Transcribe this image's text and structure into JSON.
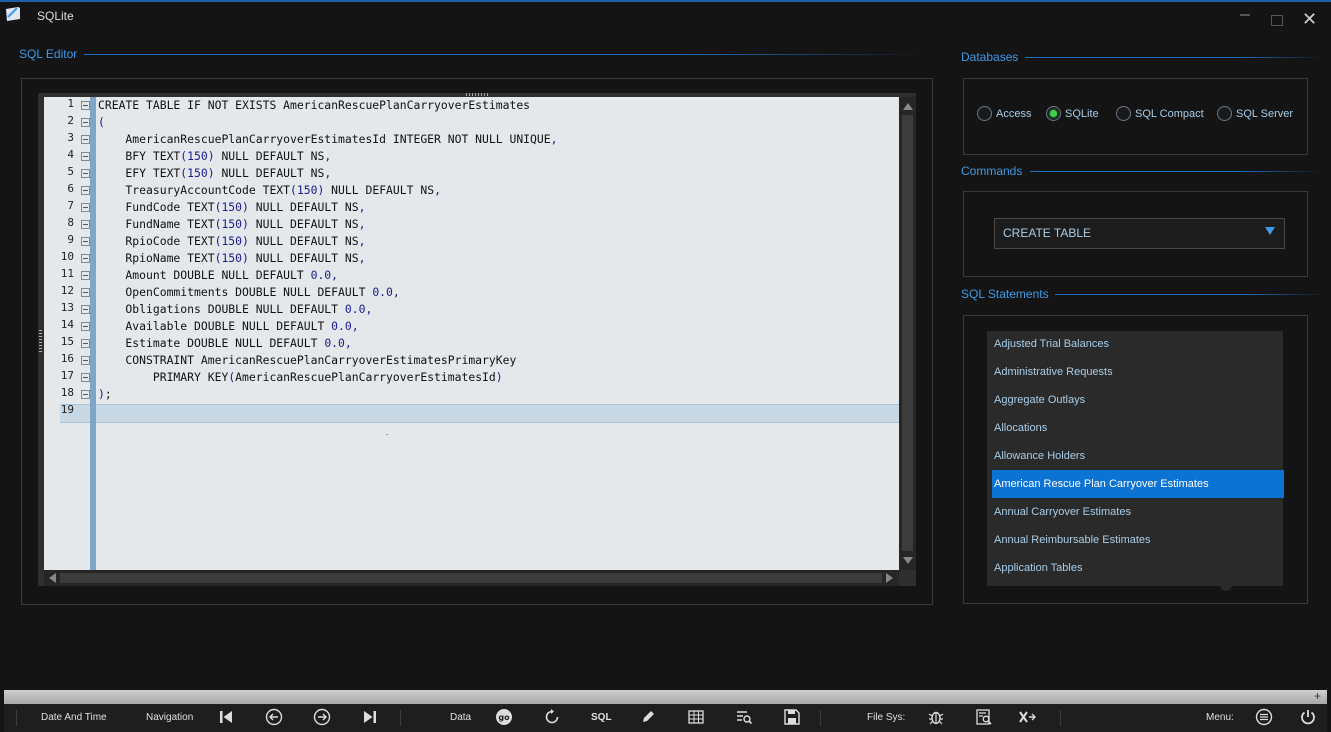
{
  "window": {
    "title": "SQLite",
    "close_symbol": "✕"
  },
  "sql_editor": {
    "title": "SQL Editor",
    "lines": [
      "CREATE TABLE IF NOT EXISTS AmericanRescuePlanCarryoverEstimates",
      "(",
      "    AmericanRescuePlanCarryoverEstimatesId INTEGER NOT NULL UNIQUE,",
      "    BFY TEXT(150) NULL DEFAULT NS,",
      "    EFY TEXT(150) NULL DEFAULT NS,",
      "    TreasuryAccountCode TEXT(150) NULL DEFAULT NS,",
      "    FundCode TEXT(150) NULL DEFAULT NS,",
      "    FundName TEXT(150) NULL DEFAULT NS,",
      "    RpioCode TEXT(150) NULL DEFAULT NS,",
      "    RpioName TEXT(150) NULL DEFAULT NS,",
      "    Amount DOUBLE NULL DEFAULT 0.0,",
      "    OpenCommitments DOUBLE NULL DEFAULT 0.0,",
      "    Obligations DOUBLE NULL DEFAULT 0.0,",
      "    Available DOUBLE NULL DEFAULT 0.0,",
      "    Estimate DOUBLE NULL DEFAULT 0.0,",
      "    CONSTRAINT AmericanRescuePlanCarryoverEstimatesPrimaryKey",
      "        PRIMARY KEY(AmericanRescuePlanCarryoverEstimatesId)",
      ");",
      ""
    ],
    "current_line": 19
  },
  "databases": {
    "title": "Databases",
    "options": [
      {
        "label": "Access",
        "selected": false
      },
      {
        "label": "SQLite",
        "selected": true
      },
      {
        "label": "SQL Compact",
        "selected": false
      },
      {
        "label": "SQL Server",
        "selected": false
      }
    ]
  },
  "commands": {
    "title": "Commands",
    "selected": "CREATE TABLE"
  },
  "sql_statements": {
    "title": "SQL Statements",
    "items": [
      "Adjusted Trial Balances",
      "Administrative Requests",
      "Aggregate Outlays",
      "Allocations",
      "Allowance Holders",
      "American Rescue Plan Carryover Estimates",
      "Annual Carryover Estimates",
      "Annual Reimbursable Estimates",
      "Application Tables"
    ],
    "selected_index": 5
  },
  "toolbar": {
    "date_time": "Date And Time",
    "navigation": "Navigation",
    "data": "Data",
    "sql": "SQL",
    "file_sys": "File Sys:",
    "menu": "Menu:",
    "plus": "+",
    "icons": {
      "first": "skip-first-icon",
      "prev": "arrow-left-icon",
      "next": "arrow-right-icon",
      "last": "skip-last-icon",
      "go": "go-icon",
      "refresh": "refresh-icon",
      "edit": "pencil-icon",
      "grid": "grid-icon",
      "query": "table-search-icon",
      "save": "save-icon",
      "bug": "bug-icon",
      "browse": "file-search-icon",
      "excel": "excel-icon",
      "menu": "menu-icon",
      "power": "power-icon"
    }
  },
  "colors": {
    "accent": "#3f9ae8",
    "selection": "#0b73d4",
    "radio_on": "#3bd14a",
    "editor_bg": "#e4e8ea"
  }
}
